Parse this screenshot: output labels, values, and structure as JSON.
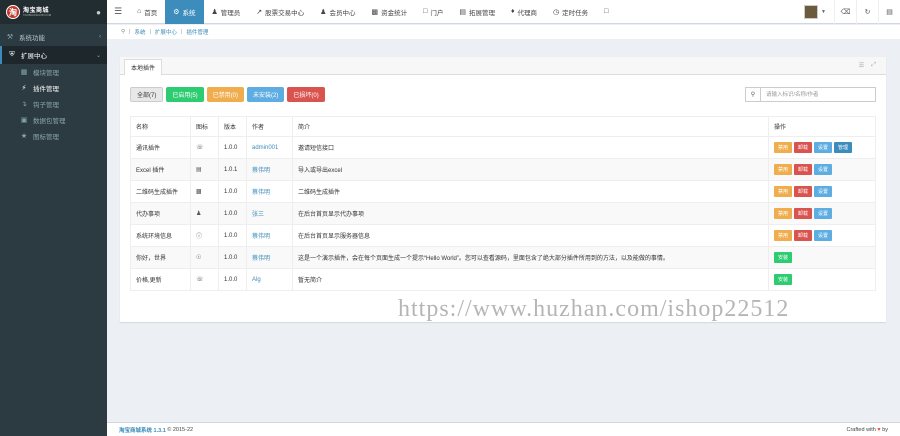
{
  "sidebar": {
    "logo_text": "淘宝商城",
    "logo_sub": "TAOBAOSHOP.COM",
    "logo_mark": "淘",
    "theme_icon": "drop-icon",
    "items": [
      {
        "label": "系统功能",
        "icon": "wrench-icon"
      },
      {
        "label": "扩展中心",
        "icon": "shield-icon"
      }
    ],
    "submenu": [
      {
        "label": "模块管理",
        "icon": "grid-icon"
      },
      {
        "label": "插件管理",
        "icon": "bolt-icon"
      },
      {
        "label": "钩子管理",
        "icon": "hook-icon"
      },
      {
        "label": "数据包管理",
        "icon": "package-icon"
      },
      {
        "label": "图标管理",
        "icon": "star-icon"
      }
    ]
  },
  "topnav": {
    "items": [
      {
        "label": "首页",
        "icon": "home-icon"
      },
      {
        "label": "系统",
        "icon": "gear-icon"
      },
      {
        "label": "管理员",
        "icon": "user-icon"
      },
      {
        "label": "股票交易中心",
        "icon": "chart-icon"
      },
      {
        "label": "会员中心",
        "icon": "users-icon"
      },
      {
        "label": "资金统计",
        "icon": "stats-icon"
      },
      {
        "label": "门户",
        "icon": "window-icon"
      },
      {
        "label": "拓展管理",
        "icon": "list-icon"
      },
      {
        "label": "代理商",
        "icon": "agent-icon"
      },
      {
        "label": "定时任务",
        "icon": "clock-icon"
      },
      {
        "label": "",
        "icon": "tag-icon"
      }
    ]
  },
  "breadcrumb": [
    "系统",
    "扩展中心",
    "插件管理"
  ],
  "panel": {
    "tab": "本地插件",
    "filters": [
      "全部(7)",
      "已启用(5)",
      "已禁用(0)",
      "未安装(2)",
      "已损坏(0)"
    ],
    "search_placeholder": "请输入标识/名称/作者",
    "columns": [
      "名称",
      "图标",
      "版本",
      "作者",
      "简介",
      "操作"
    ],
    "rows": [
      {
        "name": "通讯插件",
        "version": "1.0.0",
        "author": "admin001",
        "intro": "邀请短信接口",
        "ops": [
          "禁用",
          "卸载",
          "设置",
          "管理"
        ]
      },
      {
        "name": "Excel 插件",
        "version": "1.0.1",
        "author": "蔡伟明",
        "intro": "导入或导出excel",
        "ops": [
          "禁用",
          "卸载",
          "设置"
        ]
      },
      {
        "name": "二维码生成插件",
        "version": "1.0.0",
        "author": "蔡伟明",
        "intro": "二维码生成插件",
        "ops": [
          "禁用",
          "卸载",
          "设置"
        ]
      },
      {
        "name": "代办事项",
        "version": "1.0.0",
        "author": "张三",
        "intro": "在后台首页显示代办事项",
        "ops": [
          "禁用",
          "卸载",
          "设置"
        ]
      },
      {
        "name": "系统环境信息",
        "version": "1.0.0",
        "author": "蔡伟明",
        "intro": "在后台首页显示服务器信息",
        "ops": [
          "禁用",
          "卸载",
          "设置"
        ]
      },
      {
        "name": "你好，世界",
        "version": "1.0.0",
        "author": "蔡伟明",
        "intro": "这是一个演示插件，会在每个页面生成一个提示“Hello World”。您可以查看源码，里面包含了绝大部分插件所用到的方法，以及能做的事情。",
        "ops": [
          "安装"
        ]
      },
      {
        "name": "价格,更新",
        "version": "1.0.0",
        "author": "Alg",
        "intro": "暂无简介",
        "ops": [
          "安装"
        ]
      }
    ]
  },
  "watermark": "https://www.huzhan.com/ishop22512",
  "footer": {
    "brand": "淘宝商城系统 1.3.1",
    "copy": "© 2015-22",
    "crafted": "Crafted with",
    "by": "by"
  },
  "colors": {
    "primary": "#3c8dbc",
    "sidebar": "#2c3b41",
    "success": "#2ecc71",
    "warning": "#f0ad4e",
    "info": "#5dade2",
    "danger": "#d9534f"
  }
}
